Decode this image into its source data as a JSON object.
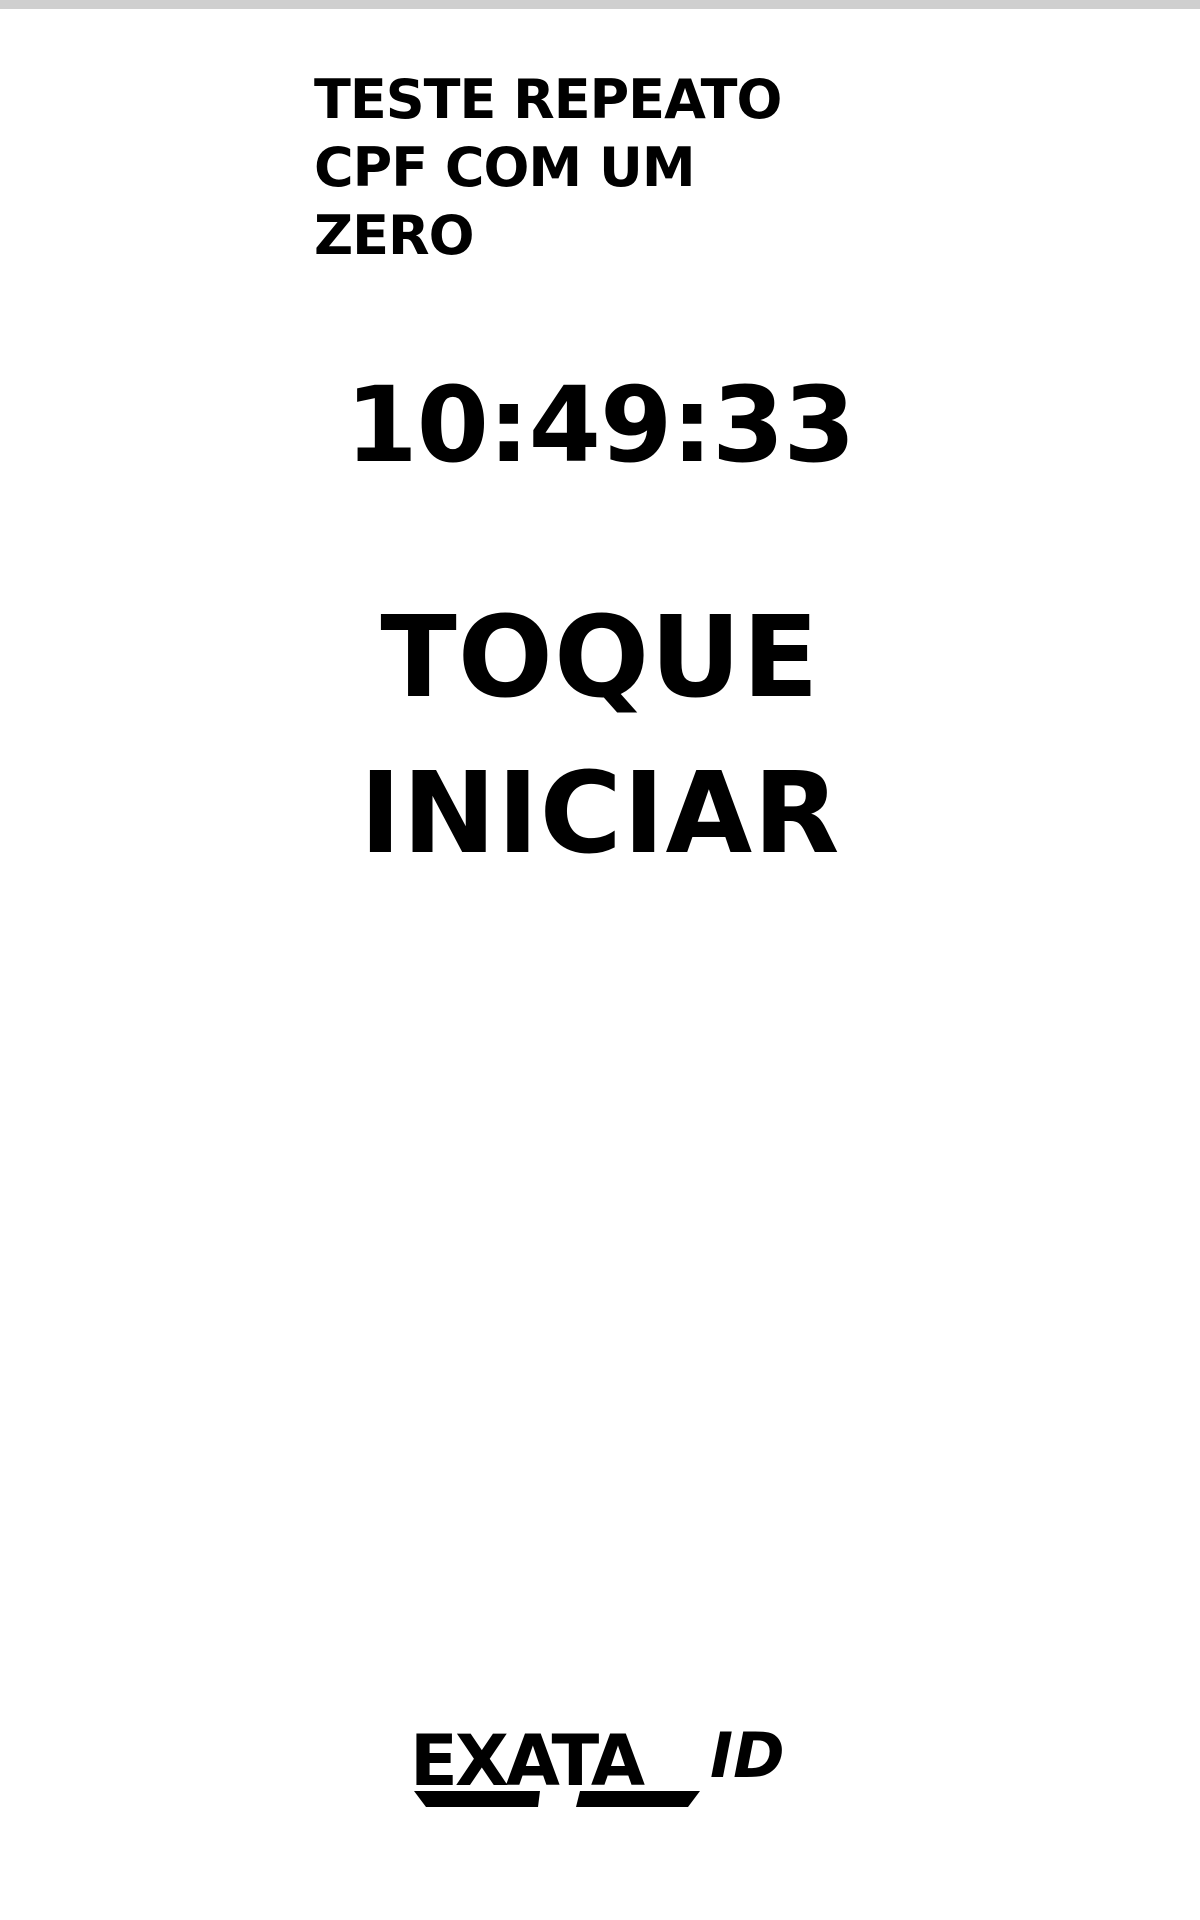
{
  "message": {
    "lines": [
      "TESTE REPEATO",
      "CPF COM UM",
      "ZERO"
    ]
  },
  "clock": "10:49:33",
  "prompt": {
    "lines": [
      "TOQUE",
      "INICIAR"
    ]
  },
  "brand": {
    "logo_main": "EXATA",
    "logo_suffix": "ID"
  }
}
